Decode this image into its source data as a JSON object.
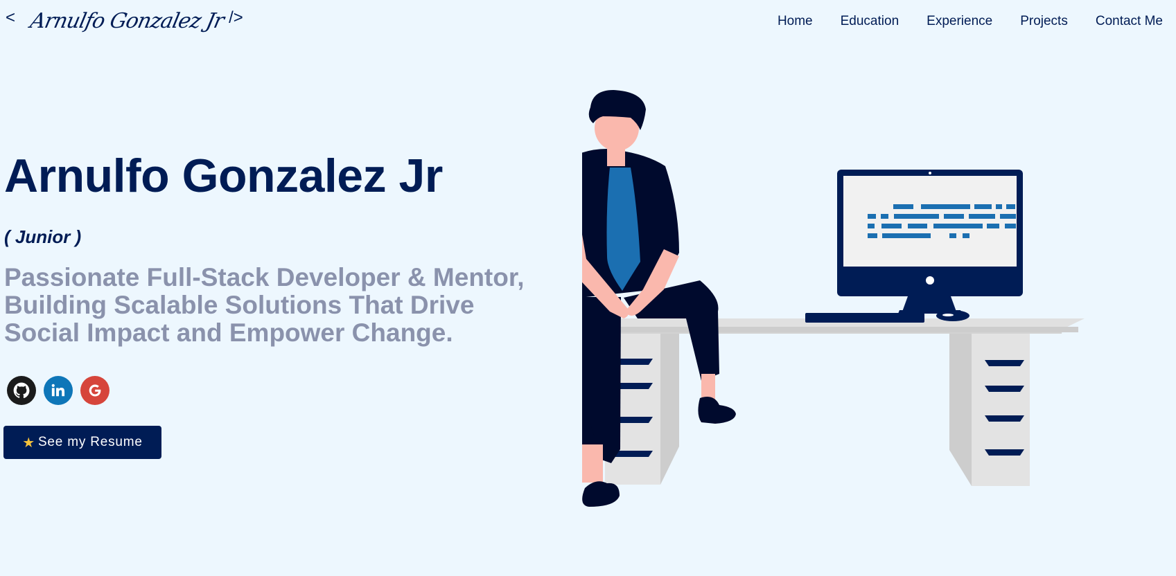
{
  "header": {
    "logo": {
      "open": "<",
      "signature": "Arnulfo Gonzalez Jr",
      "close": "/>"
    },
    "nav": [
      "Home",
      "Education",
      "Experience",
      "Projects",
      "Contact Me"
    ]
  },
  "hero": {
    "name": "Arnulfo Gonzalez Jr",
    "subtitle": "( Junior )",
    "tagline_lines": [
      "Passionate Full-Stack Developer & Mentor,",
      "Building Scalable Solutions That Drive",
      "Social Impact and Empower Change."
    ],
    "socials": [
      {
        "icon": "github-icon",
        "color": "#1b1b1b"
      },
      {
        "icon": "linkedin-icon",
        "color": "#0e76b8"
      },
      {
        "icon": "google-icon",
        "color": "#d6453b"
      }
    ],
    "resume_button": {
      "icon": "star-icon",
      "label": "See my Resume"
    }
  },
  "colors": {
    "background": "#edf7fe",
    "primary": "#001c55",
    "tagline": "#8a92ac",
    "accent_blue": "#1b6fb1",
    "skin": "#fab8ad",
    "desk": "#e3e3e3"
  }
}
